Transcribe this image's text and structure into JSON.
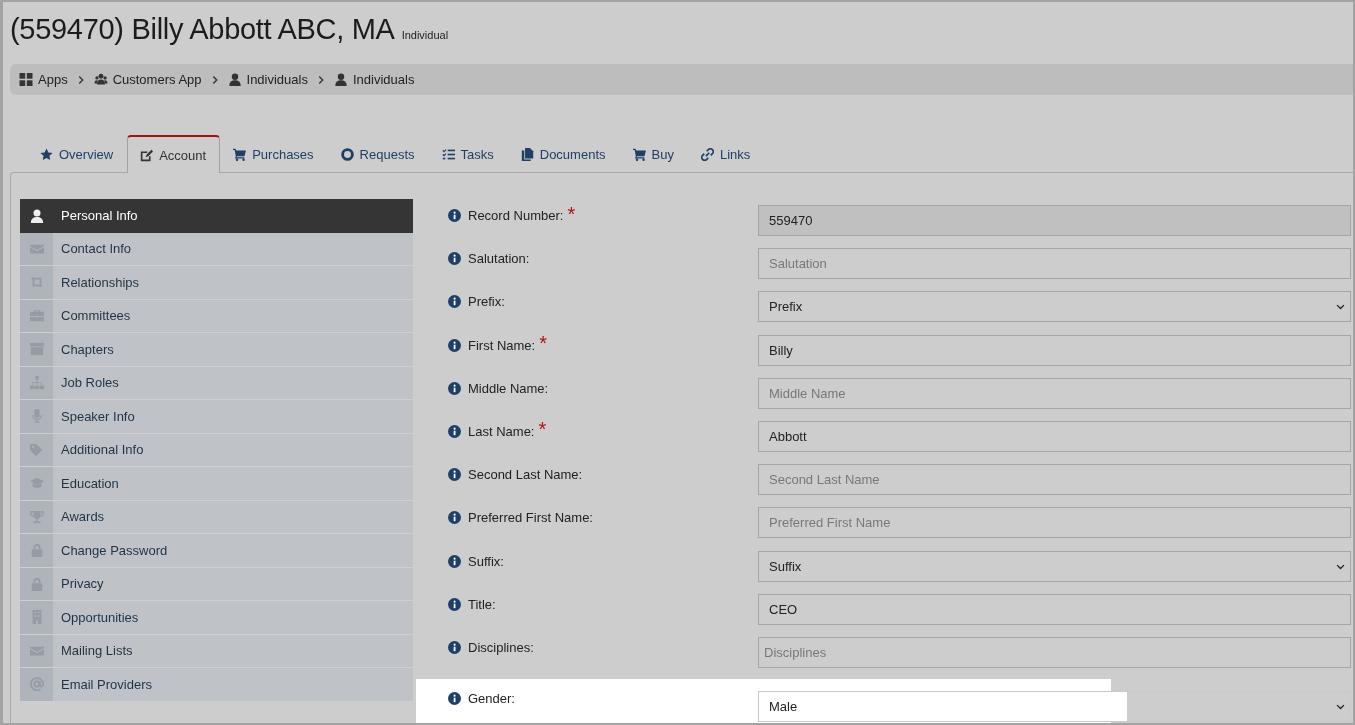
{
  "header": {
    "title": "(559470) Billy Abbott ABC, MA",
    "subtitle": "Individual"
  },
  "breadcrumbs": [
    {
      "label": "Apps"
    },
    {
      "label": "Customers App"
    },
    {
      "label": "Individuals"
    },
    {
      "label": "Individuals"
    }
  ],
  "tabs": [
    {
      "label": "Overview",
      "selected": false
    },
    {
      "label": "Account",
      "selected": true
    },
    {
      "label": "Purchases",
      "selected": false
    },
    {
      "label": "Requests",
      "selected": false
    },
    {
      "label": "Tasks",
      "selected": false
    },
    {
      "label": "Documents",
      "selected": false
    },
    {
      "label": "Buy",
      "selected": false
    },
    {
      "label": "Links",
      "selected": false
    }
  ],
  "sidebar": {
    "items": [
      {
        "label": "Personal Info",
        "selected": true
      },
      {
        "label": "Contact Info",
        "selected": false
      },
      {
        "label": "Relationships",
        "selected": false
      },
      {
        "label": "Committees",
        "selected": false
      },
      {
        "label": "Chapters",
        "selected": false
      },
      {
        "label": "Job Roles",
        "selected": false
      },
      {
        "label": "Speaker Info",
        "selected": false
      },
      {
        "label": "Additional Info",
        "selected": false
      },
      {
        "label": "Education",
        "selected": false
      },
      {
        "label": "Awards",
        "selected": false
      },
      {
        "label": "Change Password",
        "selected": false
      },
      {
        "label": "Privacy",
        "selected": false
      },
      {
        "label": "Opportunities",
        "selected": false
      },
      {
        "label": "Mailing Lists",
        "selected": false
      },
      {
        "label": "Email Providers",
        "selected": false
      }
    ]
  },
  "form": {
    "fields": [
      {
        "label": "Record Number:",
        "required_mark": "*",
        "kind": "input",
        "value": "559470",
        "disabled": true,
        "highlighted": false
      },
      {
        "label": "Salutation:",
        "kind": "input",
        "placeholder": "Salutation",
        "disabled": false,
        "highlighted": false
      },
      {
        "label": "Prefix:",
        "kind": "select",
        "value": "Prefix",
        "disabled": false,
        "highlighted": false
      },
      {
        "label": "First Name:",
        "required_mark": "*",
        "kind": "input",
        "value": "Billy",
        "disabled": false,
        "highlighted": false
      },
      {
        "label": "Middle Name:",
        "kind": "input",
        "placeholder": "Middle Name",
        "disabled": false,
        "highlighted": false
      },
      {
        "label": "Last Name:",
        "required_mark": "*",
        "kind": "input",
        "value": "Abbott",
        "disabled": false,
        "highlighted": false
      },
      {
        "label": "Second Last Name:",
        "kind": "input",
        "placeholder": "Second Last Name",
        "disabled": false,
        "highlighted": false
      },
      {
        "label": "Preferred First Name:",
        "kind": "input",
        "placeholder": "Preferred First Name",
        "disabled": false,
        "highlighted": false
      },
      {
        "label": "Suffix:",
        "kind": "select",
        "value": "Suffix",
        "disabled": false,
        "highlighted": false
      },
      {
        "label": "Title:",
        "kind": "input",
        "value": "CEO",
        "disabled": false,
        "highlighted": false
      },
      {
        "label": "Disciplines:",
        "kind": "tags",
        "placeholder": "Disciplines",
        "disabled": false,
        "highlighted": false
      },
      {
        "label": "Gender:",
        "kind": "select",
        "value": "Male",
        "disabled": false,
        "highlighted": true
      }
    ]
  }
}
